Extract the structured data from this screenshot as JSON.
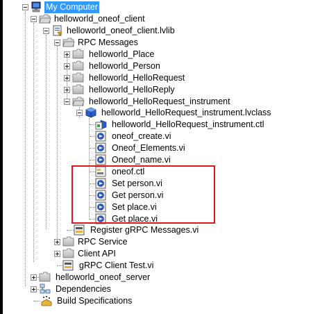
{
  "project_tree": {
    "root": {
      "label": "My Computer"
    },
    "client_folder": {
      "label": "helloworld_oneof_client"
    },
    "client_lib": {
      "label": "helloworld_oneof_client.lvlib"
    },
    "rpc_messages": {
      "label": "RPC Messages"
    },
    "place": {
      "label": "helloworld_Place"
    },
    "person": {
      "label": "helloworld_Person"
    },
    "hello_request": {
      "label": "helloworld_HelloRequest"
    },
    "hello_reply": {
      "label": "helloworld_HelloReply"
    },
    "instrument_folder": {
      "label": "helloworld_HelloRequest_instrument"
    },
    "instrument_class": {
      "label": "helloworld_HelloRequest_instrument.lvclass"
    },
    "class_items": [
      {
        "label": "helloworld_HelloRequest_instrument.ctl"
      },
      {
        "label": "oneof_create.vi"
      },
      {
        "label": "Oneof_Elements.vi"
      },
      {
        "label": "Oneof_name.vi"
      },
      {
        "label": "oneof.ctl"
      },
      {
        "label": "Set person.vi"
      },
      {
        "label": "Get person.vi"
      },
      {
        "label": "Set place.vi"
      },
      {
        "label": "Get place.vi"
      }
    ],
    "register_vi": {
      "label": "Register gRPC Messages.vi"
    },
    "rpc_service": {
      "label": "RPC Service"
    },
    "client_api": {
      "label": "Client API"
    },
    "client_test": {
      "label": "gRPC Client Test.vi"
    },
    "server_folder": {
      "label": "helloworld_oneof_server"
    },
    "dependencies": {
      "label": "Dependencies"
    },
    "build_specs": {
      "label": "Build Specifications"
    }
  },
  "colors": {
    "selection": "#3399ff",
    "highlight_border": "#e0161b",
    "folder": "#c9c9c9"
  },
  "icons": {
    "root": "computer-icon",
    "folder": "folder-icon",
    "library": "library-icon",
    "class": "class-icon",
    "vi": "vi-icon",
    "control": "control-icon",
    "dependencies": "dependencies-icon",
    "build": "build-specifications-icon"
  }
}
